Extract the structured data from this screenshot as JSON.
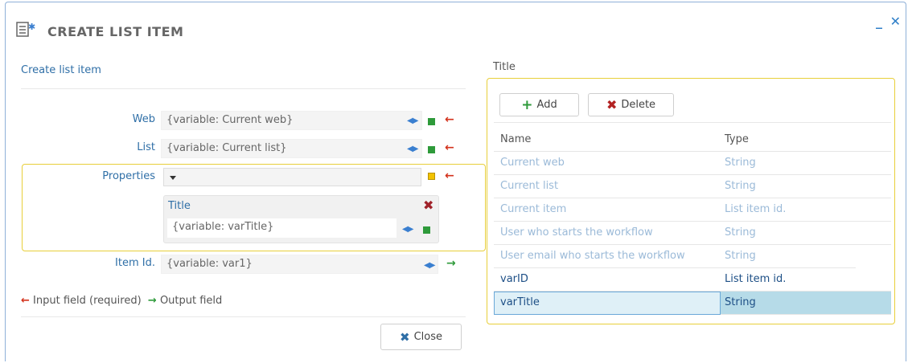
{
  "window": {
    "title": "CREATE LIST ITEM",
    "minimize_label": "_",
    "close_label": "✕"
  },
  "left": {
    "section_link": "Create list item",
    "web": {
      "label": "Web",
      "value": "{variable: Current web}"
    },
    "list": {
      "label": "List",
      "value": "{variable: Current list}"
    },
    "properties": {
      "label": "Properties",
      "item_title": "Title",
      "item_value": "{variable: varTitle}"
    },
    "item_id": {
      "label": "Item Id.",
      "value": "{variable: var1}"
    },
    "legend": {
      "input_text": "Input field (required)",
      "output_text": "Output field"
    },
    "close_button": "Close"
  },
  "right": {
    "label": "Title",
    "add_button": "Add",
    "delete_button": "Delete",
    "columns": [
      "Name",
      "Type"
    ],
    "rows": [
      {
        "name": "Current web",
        "type": "String",
        "style": "dim"
      },
      {
        "name": "Current list",
        "type": "String",
        "style": "dim"
      },
      {
        "name": "Current item",
        "type": "List item id.",
        "style": "dim"
      },
      {
        "name": "User who starts the workflow",
        "type": "String",
        "style": "dim"
      },
      {
        "name": "User email who starts the workflow",
        "type": "String",
        "style": "dim"
      },
      {
        "name": "varID",
        "type": "List item id.",
        "style": "strong"
      },
      {
        "name": "varTitle",
        "type": "String",
        "style": "selected"
      }
    ]
  },
  "colors": {
    "accent_blue": "#2f6fa7",
    "highlight_yellow": "#e8cf3a",
    "required_red": "#d3321c",
    "output_green": "#2e9a3a",
    "selected_row": "#b6dbe8"
  }
}
